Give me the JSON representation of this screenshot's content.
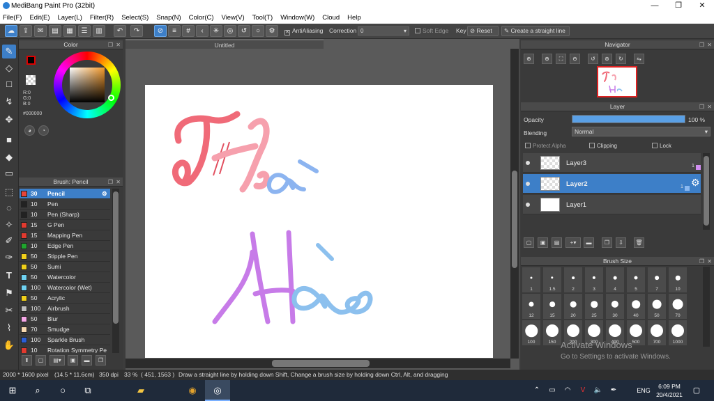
{
  "window": {
    "title": "MediBang Paint Pro (32bit)"
  },
  "menu": [
    "File(F)",
    "Edit(E)",
    "Layer(L)",
    "Filter(R)",
    "Select(S)",
    "Snap(N)",
    "Color(C)",
    "View(V)",
    "Tool(T)",
    "Window(W)",
    "Cloud",
    "Help"
  ],
  "toolbar": {
    "antialiasing_label": "AntiAliasing",
    "correction_label": "Correction",
    "correction_value": "0",
    "soft_edge_label": "Soft Edge",
    "key_label": "Key",
    "reset_label": "Reset",
    "straight_line_label": "Create a straight line"
  },
  "color_panel": {
    "title": "Color",
    "r": "R:0",
    "g": "G:0",
    "b": "B:0",
    "hex": "#000000",
    "primary": "#000000",
    "secondary": "#ffffff"
  },
  "brush_panel": {
    "title": "Brush: Pencil",
    "brushes": [
      {
        "size": "30",
        "name": "Pencil",
        "color": "#e8443a"
      },
      {
        "size": "10",
        "name": "Pen",
        "color": "#222222"
      },
      {
        "size": "10",
        "name": "Pen (Sharp)",
        "color": "#222222"
      },
      {
        "size": "15",
        "name": "G Pen",
        "color": "#e23a2f"
      },
      {
        "size": "15",
        "name": "Mapping Pen",
        "color": "#e23a2f"
      },
      {
        "size": "10",
        "name": "Edge Pen",
        "color": "#1fa52d"
      },
      {
        "size": "50",
        "name": "Stipple Pen",
        "color": "#f0d01a"
      },
      {
        "size": "50",
        "name": "Sumi",
        "color": "#f0d01a"
      },
      {
        "size": "50",
        "name": "Watercolor",
        "color": "#6fd2f2"
      },
      {
        "size": "100",
        "name": "Watercolor (Wet)",
        "color": "#6fd2f2"
      },
      {
        "size": "50",
        "name": "Acrylic",
        "color": "#f0d01a"
      },
      {
        "size": "100",
        "name": "Airbrush",
        "color": "#bdbdbd"
      },
      {
        "size": "50",
        "name": "Blur",
        "color": "#f6a8e8"
      },
      {
        "size": "70",
        "name": "Smudge",
        "color": "#f7d9b0"
      },
      {
        "size": "100",
        "name": "Sparkle Brush",
        "color": "#2a5fd8"
      },
      {
        "size": "10",
        "name": "Rotation Symmetry Pe",
        "color": "#e23a2f"
      }
    ]
  },
  "document": {
    "tab": "Untitled"
  },
  "navigator": {
    "title": "Navigator"
  },
  "layer_panel": {
    "title": "Layer",
    "opacity_label": "Opacity",
    "opacity_value": "100 %",
    "opacity_fraction": 1.0,
    "blending_label": "Blending",
    "blending_value": "Normal",
    "protect_alpha": "Protect Alpha",
    "clipping": "Clipping",
    "lock": "Lock",
    "layers": [
      {
        "name": "Layer3",
        "badge": "1"
      },
      {
        "name": "Layer2",
        "badge": "1"
      },
      {
        "name": "Layer1",
        "badge": ""
      }
    ]
  },
  "brush_size_panel": {
    "title": "Brush Size",
    "sizes": [
      "1",
      "1.5",
      "2",
      "3",
      "4",
      "5",
      "7",
      "10",
      "12",
      "15",
      "20",
      "25",
      "30",
      "40",
      "50",
      "70",
      "100",
      "150",
      "200",
      "300",
      "400",
      "500",
      "700",
      "1000"
    ]
  },
  "watermark": {
    "line1": "Activate Windows",
    "line2": "Go to Settings to activate Windows."
  },
  "status": {
    "size": "2000 * 1600 pixel",
    "physical": "(14.5 * 11.6cm)",
    "dpi": "350 dpi",
    "zoom": "33 %",
    "coords": "( 451, 1563 )",
    "hint": "Draw a straight line by holding down Shift, Change a brush size by holding down Ctrl, Alt, and dragging"
  },
  "taskbar": {
    "lang": "ENG",
    "time": "6:09 PM",
    "date": "20/4/2021"
  }
}
